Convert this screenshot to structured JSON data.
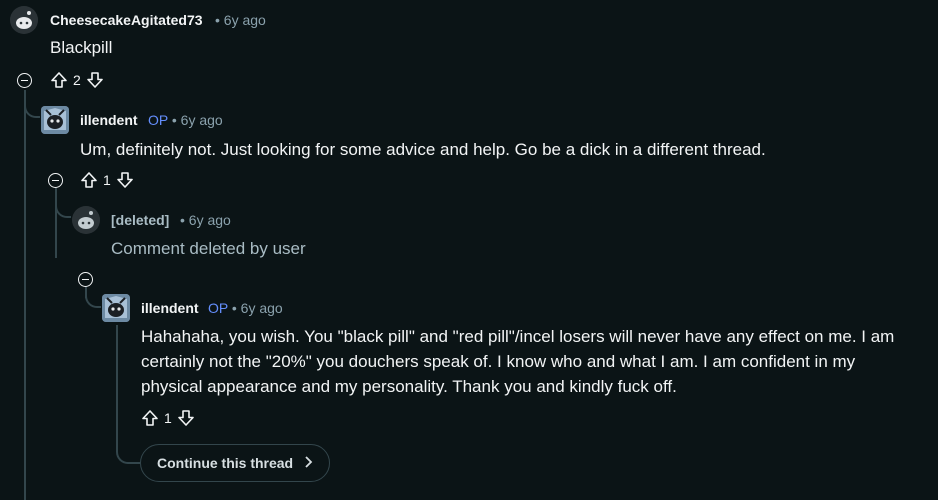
{
  "comments": [
    {
      "author": "CheesecakeAgitated73",
      "time": "6y ago",
      "text": "Blackpill",
      "votes": "2",
      "avatar": "snoo-default-avatar"
    },
    {
      "author": "illendent",
      "op_badge": "OP",
      "time": "6y ago",
      "text": "Um, definitely not. Just looking for some advice and help. Go be a dick in a different thread.",
      "votes": "1",
      "avatar": "custom-snoo-avatar"
    },
    {
      "author": "[deleted]",
      "time": "6y ago",
      "text": "Comment deleted by user",
      "avatar": "snoo-default-avatar"
    },
    {
      "author": "illendent",
      "op_badge": "OP",
      "time": "6y ago",
      "text_lines": [
        "Hahahaha, you wish. You \"black pill\" and \"red pill\"/incel losers will never have any effect on me. I am",
        "certainly not the \"20%\" you douchers speak of. I know who and what I am. I am confident in my",
        "physical appearance and my personality. Thank you and kindly fuck off."
      ],
      "votes": "1",
      "avatar": "custom-snoo-avatar"
    }
  ],
  "separator": "•",
  "continue_thread": "Continue this thread",
  "colors": {
    "background": "#0b1416",
    "text": "#f2f4f5",
    "meta": "#8ba2ad",
    "op": "#648efc",
    "thread_line": "#33464c"
  }
}
